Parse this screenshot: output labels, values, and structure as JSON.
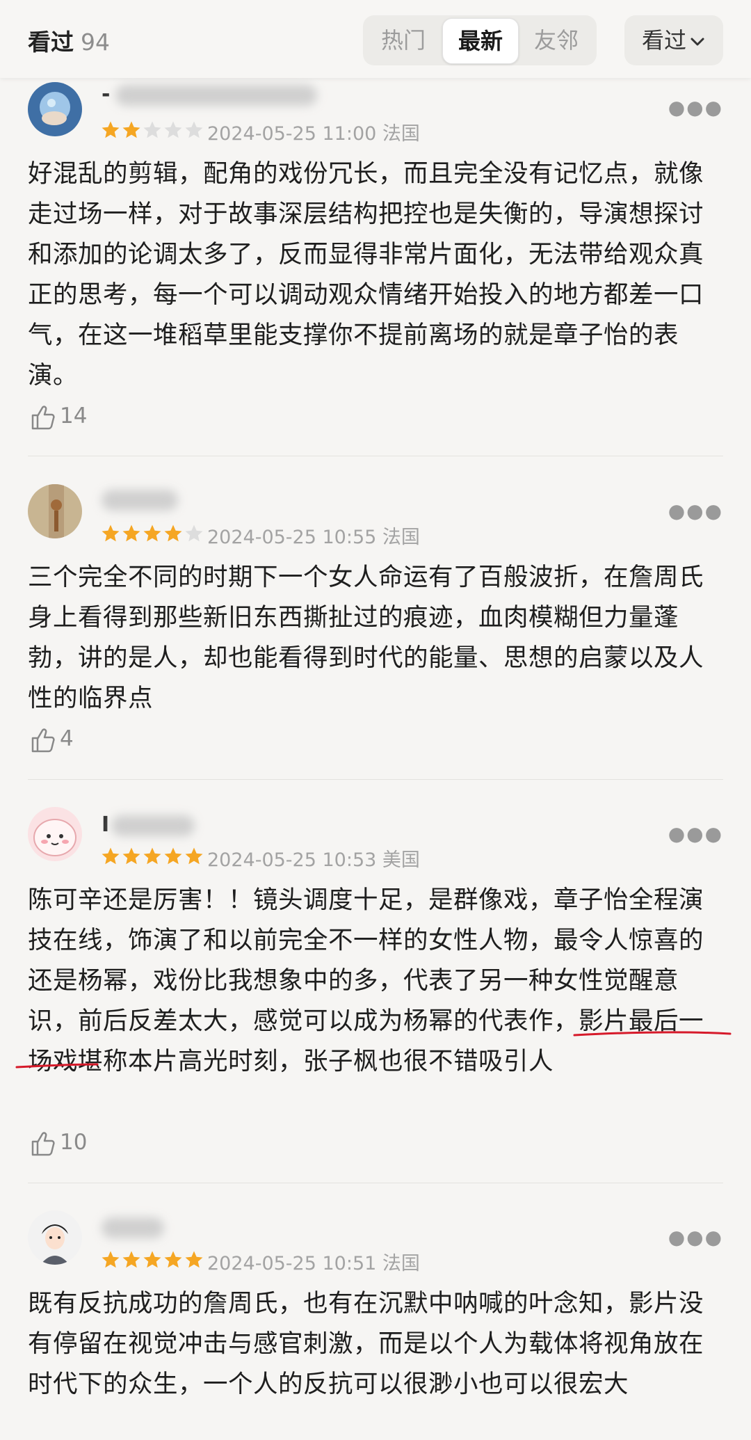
{
  "header": {
    "section_label": "看过",
    "section_count": "94",
    "tabs": [
      {
        "label": "热门",
        "active": false
      },
      {
        "label": "最新",
        "active": true
      },
      {
        "label": "友邻",
        "active": false
      }
    ],
    "filter_label": "看过"
  },
  "reviews": [
    {
      "username_prefix": "-",
      "rating": 2,
      "date": "2024-05-25 11:00",
      "location": "法国",
      "content": "好混乱的剪辑，配角的戏份冗长，而且完全没有记忆点，就像走过场一样，对于故事深层结构把控也是失衡的，导演想探讨和添加的论调太多了，反而显得非常片面化，无法带给观众真正的思考，每一个可以调动观众情绪开始投入的地方都差一口气，在这一堆稻草里能支撑你不提前离场的就是章子怡的表演。",
      "likes": "14"
    },
    {
      "username_prefix": "",
      "rating": 4,
      "date": "2024-05-25 10:55",
      "location": "法国",
      "content": "三个完全不同的时期下一个女人命运有了百般波折，在詹周氏身上看得到那些新旧东西撕扯过的痕迹，血肉模糊但力量蓬勃，讲的是人，却也能看得到时代的能量、思想的启蒙以及人性的临界点",
      "likes": "4"
    },
    {
      "username_prefix": "I",
      "rating": 5,
      "date": "2024-05-25 10:53",
      "location": "美国",
      "content": "陈可辛还是厉害！！镜头调度十足，是群像戏，章子怡全程演技在线，饰演了和以前完全不一样的女性人物，最令人惊喜的还是杨幂，戏份比我想象中的多，代表了另一种女性觉醒意识，前后反差太大，感觉可以成为杨幂的代表作，影片最后一场戏堪称本片高光时刻，张子枫也很不错吸引人",
      "likes": "10"
    },
    {
      "username_prefix": "",
      "rating": 5,
      "date": "2024-05-25 10:51",
      "location": "法国",
      "content": "既有反抗成功的詹周氏，也有在沉默中呐喊的叶念知，影片没有停留在视觉冲击与感官刺激，而是以个人为载体将视角放在时代下的众生，一个人的反抗可以很渺小也可以很宏大",
      "likes": ""
    }
  ],
  "colors": {
    "star_filled": "#f5a623",
    "star_empty": "#dddddd",
    "underline_annotation": "#d61a2a"
  }
}
